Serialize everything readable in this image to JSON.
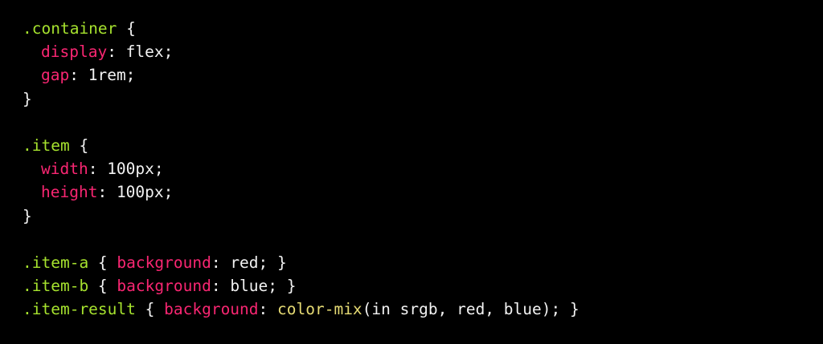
{
  "code": {
    "lines": [
      {
        "selector": ".container",
        "open": " {"
      },
      {
        "prop": "display",
        "value": "flex;"
      },
      {
        "prop": "gap",
        "value": "1rem;"
      },
      {
        "close": "}"
      },
      {
        "blank": ""
      },
      {
        "selector": ".item",
        "open": " {"
      },
      {
        "prop": "width",
        "value": "100px;"
      },
      {
        "prop": "height",
        "value": "100px;"
      },
      {
        "close": "}"
      },
      {
        "blank": ""
      },
      {
        "selector": ".item-a",
        "open": " { ",
        "prop": "background",
        "value": "red;",
        "end": " }"
      },
      {
        "selector": ".item-b",
        "open": " { ",
        "prop": "background",
        "value": "blue;",
        "end": " }"
      },
      {
        "selector": ".item-result",
        "open": " { ",
        "prop": "background",
        "fn": "color-mix",
        "args": "(in srgb, red, blue);",
        "end": " }"
      }
    ]
  },
  "colors": {
    "background": "#000000",
    "selector": "#a6e22e",
    "property": "#f92672",
    "function": "#e6db74",
    "text": "#f2f2f2"
  }
}
